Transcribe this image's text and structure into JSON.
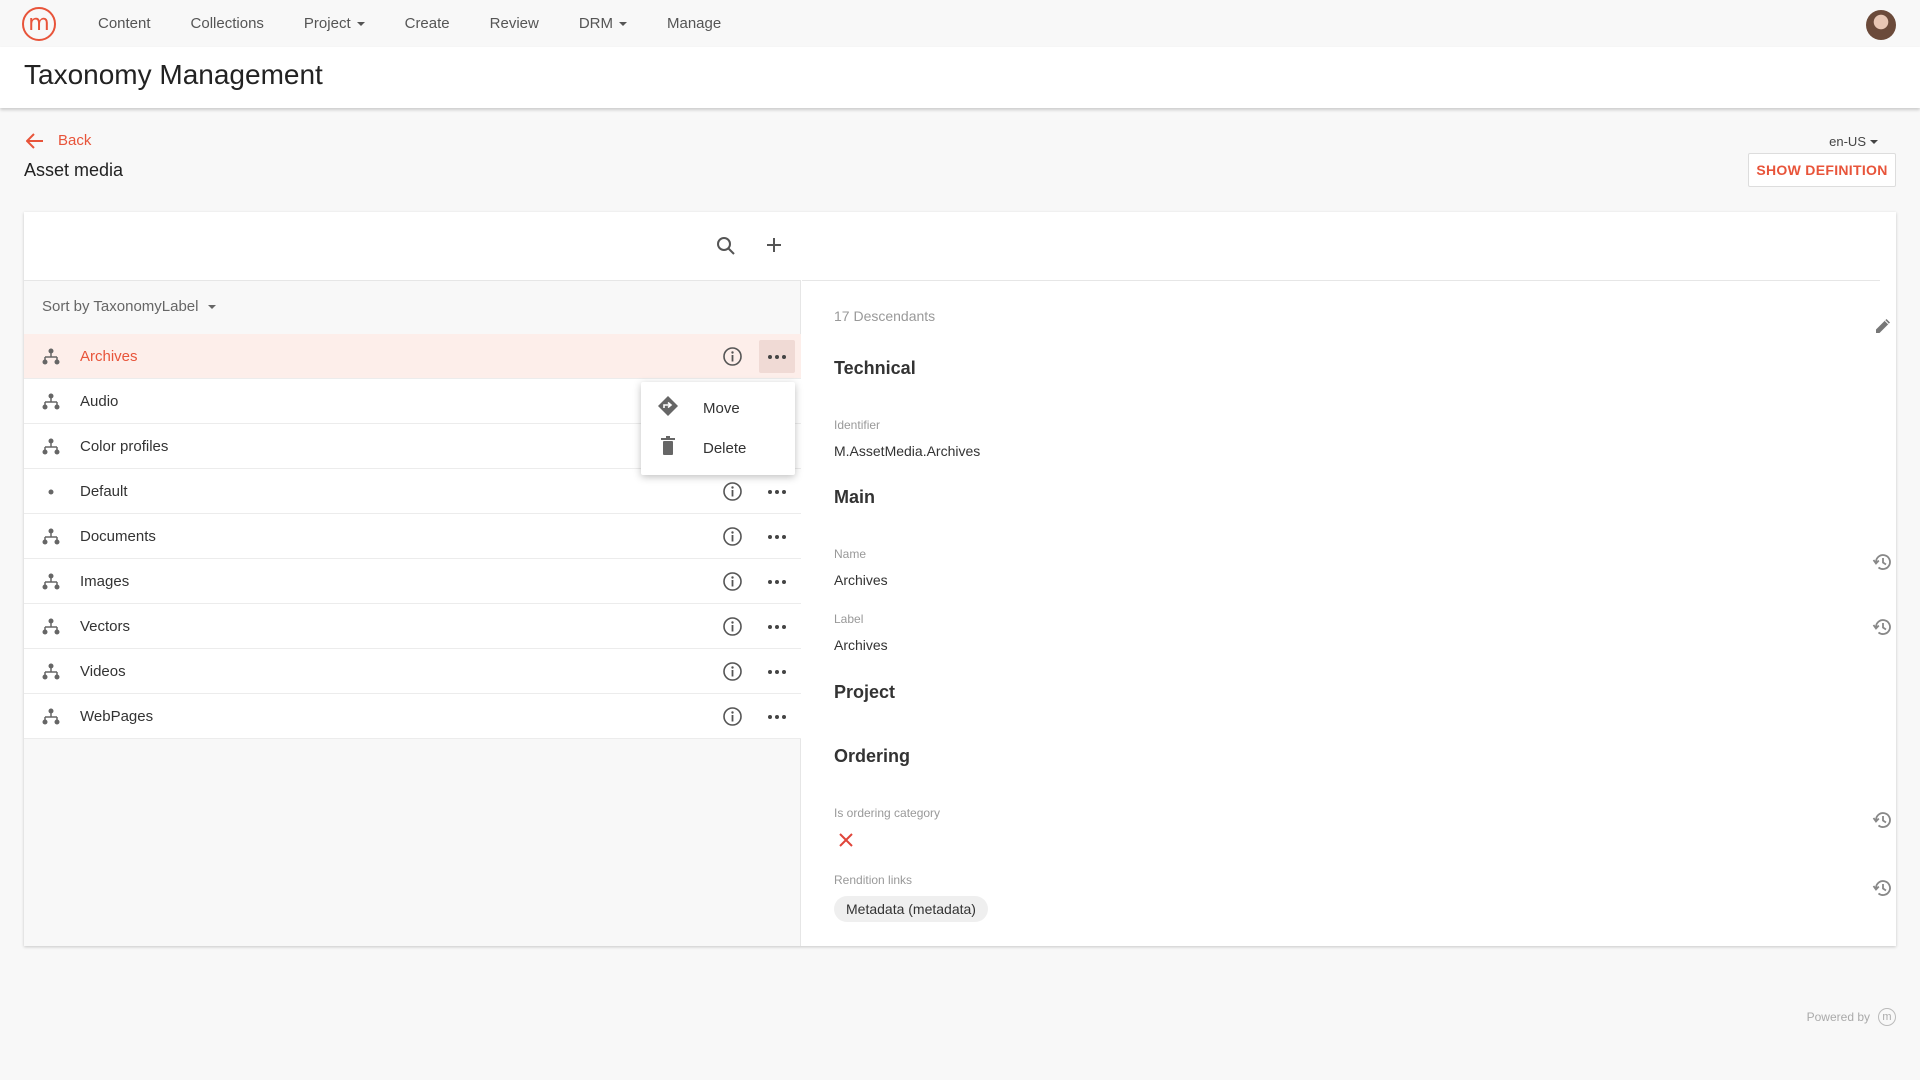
{
  "nav": {
    "logo_letter": "m",
    "items": [
      {
        "label": "Content",
        "dropdown": false
      },
      {
        "label": "Collections",
        "dropdown": false
      },
      {
        "label": "Project",
        "dropdown": true
      },
      {
        "label": "Create",
        "dropdown": false
      },
      {
        "label": "Review",
        "dropdown": false
      },
      {
        "label": "DRM",
        "dropdown": true
      },
      {
        "label": "Manage",
        "dropdown": false
      }
    ]
  },
  "header": {
    "title": "Taxonomy Management"
  },
  "page": {
    "back_label": "Back",
    "asset_title": "Asset media",
    "language": "en-US",
    "show_definition_label": "SHOW DEFINITION"
  },
  "colors": {
    "accent": "#e8543a",
    "selected_row": "#fdeeea"
  },
  "left_panel": {
    "sort_label": "Sort by TaxonomyLabel",
    "items": [
      {
        "label": "Archives",
        "icon": "tree-icon",
        "selected": true
      },
      {
        "label": "Audio",
        "icon": "tree-icon",
        "selected": false
      },
      {
        "label": "Color profiles",
        "icon": "tree-icon",
        "selected": false
      },
      {
        "label": "Default",
        "icon": "dot-icon",
        "selected": false
      },
      {
        "label": "Documents",
        "icon": "tree-icon",
        "selected": false
      },
      {
        "label": "Images",
        "icon": "tree-icon",
        "selected": false
      },
      {
        "label": "Vectors",
        "icon": "tree-icon",
        "selected": false
      },
      {
        "label": "Videos",
        "icon": "tree-icon",
        "selected": false
      },
      {
        "label": "WebPages",
        "icon": "tree-icon",
        "selected": false
      }
    ]
  },
  "context_menu": {
    "items": [
      {
        "label": "Move",
        "icon": "move-icon"
      },
      {
        "label": "Delete",
        "icon": "trash-icon"
      }
    ]
  },
  "right_panel": {
    "descendants": "17 Descendants",
    "sections": {
      "technical": "Technical",
      "main": "Main",
      "project": "Project",
      "ordering": "Ordering"
    },
    "fields": {
      "identifier_label": "Identifier",
      "identifier_value": "M.AssetMedia.Archives",
      "name_label": "Name",
      "name_value": "Archives",
      "label_label": "Label",
      "label_value": "Archives",
      "ordering_label": "Is ordering category",
      "ordering_value": false,
      "rendition_label": "Rendition links",
      "rendition_chip": "Metadata (metadata)"
    }
  },
  "footer": {
    "powered_by": "Powered by"
  }
}
